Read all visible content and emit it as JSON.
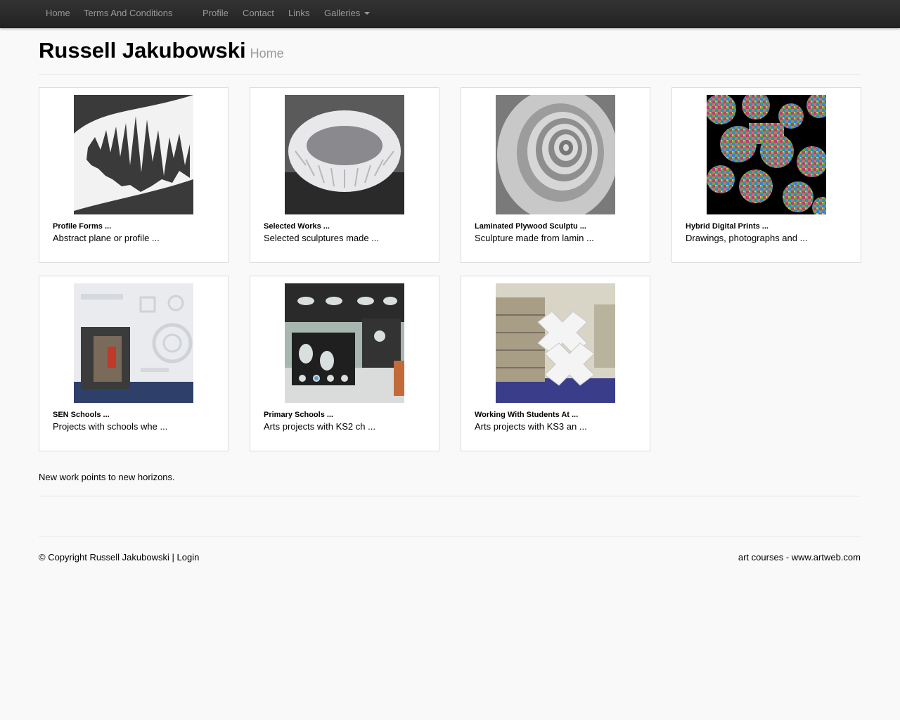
{
  "nav": {
    "home": "Home",
    "terms": "Terms And Conditions",
    "profile": "Profile",
    "contact": "Contact",
    "links": "Links",
    "galleries": "Galleries"
  },
  "header": {
    "site_name": "Russell Jakubowski",
    "page_name": "Home"
  },
  "galleries": [
    {
      "title": "Profile Forms ...",
      "desc": "Abstract plane or profile ..."
    },
    {
      "title": "Selected Works ...",
      "desc": "Selected sculptures made ..."
    },
    {
      "title": "Laminated Plywood Sculptu ...",
      "desc": "Sculpture made from lamin ..."
    },
    {
      "title": "Hybrid Digital Prints ...",
      "desc": "Drawings, photographs and ..."
    },
    {
      "title": "SEN Schools ...",
      "desc": "Projects with schools whe ..."
    },
    {
      "title": "Primary Schools ...",
      "desc": "Arts projects with KS2 ch ..."
    },
    {
      "title": "Working With Students At ...",
      "desc": "Arts projects with KS3 an ..."
    }
  ],
  "tagline": "New work points to new horizons.",
  "footer": {
    "copyright": "© Copyright Russell Jakubowski",
    "separator": "|",
    "login": "Login",
    "credit": "art courses - www.artweb.com"
  },
  "colors": {
    "navbar": "#2b2b2b",
    "nav_text": "#999999",
    "background": "#f9f9f9",
    "card_border": "#dddddd"
  }
}
